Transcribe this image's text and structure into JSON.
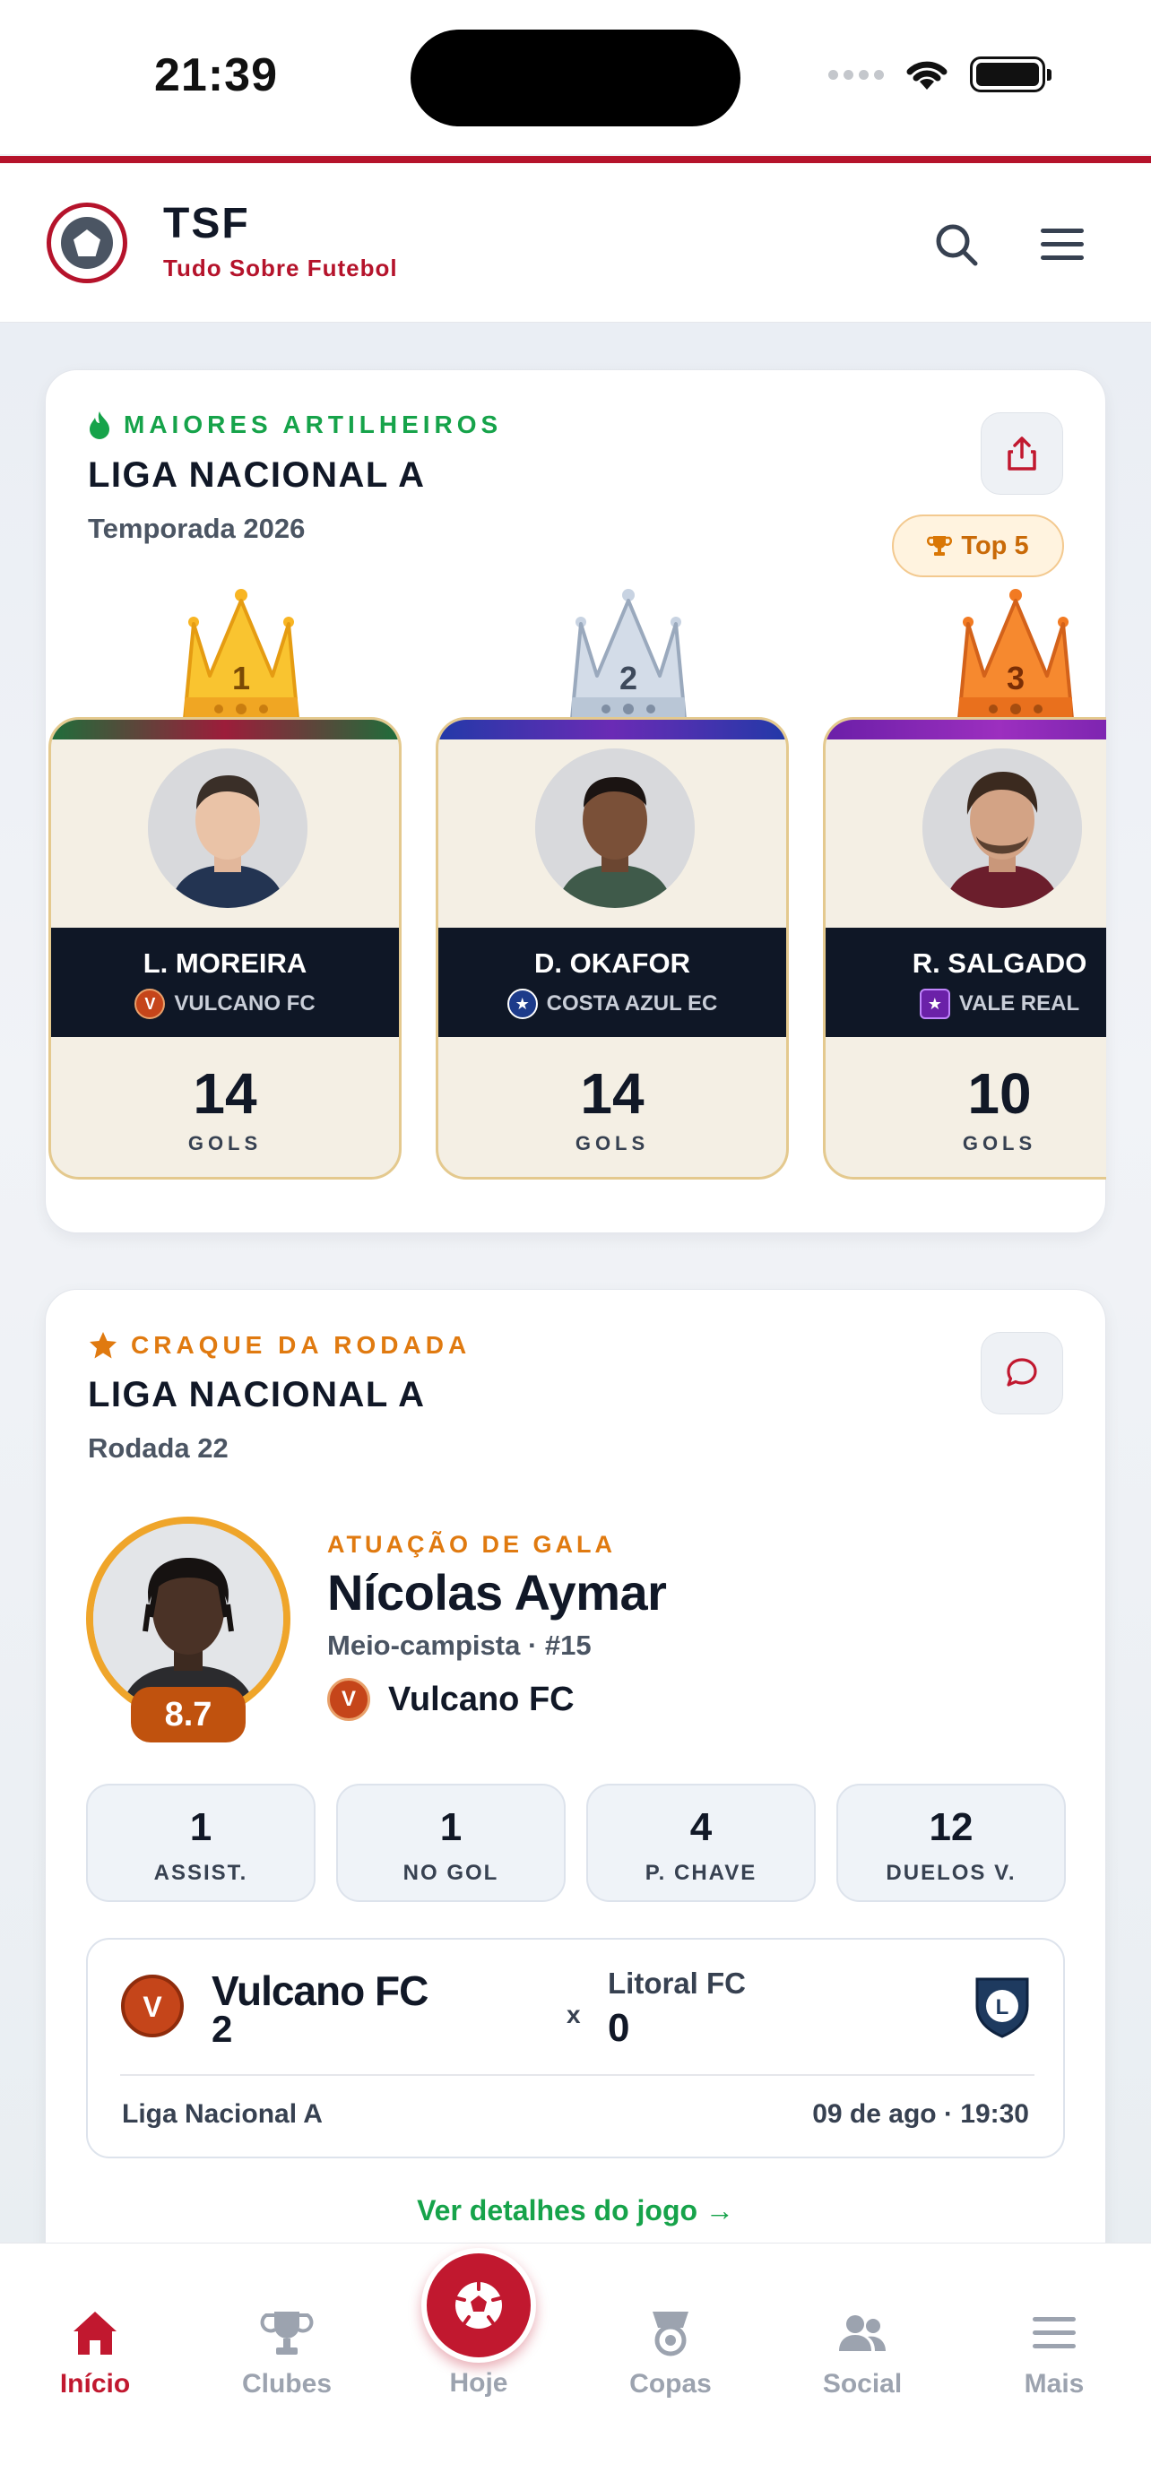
{
  "status_bar": {
    "time": "21:39"
  },
  "header": {
    "brand": "TSF",
    "tagline": "Tudo Sobre Futebol"
  },
  "top_scorers": {
    "kicker": "MAIORES ARTILHEIROS",
    "league": "LIGA NACIONAL A",
    "season": "Temporada 2026",
    "badge": "Top 5",
    "players": [
      {
        "rank": "1",
        "name": "L. MOREIRA",
        "club": "VULCANO FC",
        "goals": "14",
        "goals_label": "GOLS"
      },
      {
        "rank": "2",
        "name": "D. OKAFOR",
        "club": "COSTA AZUL EC",
        "goals": "14",
        "goals_label": "GOLS"
      },
      {
        "rank": "3",
        "name": "R. SALGADO",
        "club": "VALE REAL",
        "goals": "10",
        "goals_label": "GOLS"
      }
    ]
  },
  "player_of_round": {
    "kicker": "CRAQUE DA RODADA",
    "league": "LIGA NACIONAL A",
    "round": "Rodada 22",
    "rating": "8.7",
    "performance": "ATUAÇÃO DE GALA",
    "name": "Nícolas Aymar",
    "role": "Meio-campista · #15",
    "club": "Vulcano FC",
    "stats": [
      {
        "value": "1",
        "label": "ASSIST."
      },
      {
        "value": "1",
        "label": "NO GOL"
      },
      {
        "value": "4",
        "label": "P. CHAVE"
      },
      {
        "value": "12",
        "label": "DUELOS V."
      }
    ],
    "match": {
      "home_team": "Vulcano FC",
      "home_score": "2",
      "separator": "x",
      "away_team": "Litoral FC",
      "away_score": "0",
      "competition": "Liga Nacional A",
      "datetime": "09 de ago · 19:30"
    },
    "details_link": "Ver detalhes do jogo →"
  },
  "tabbar": {
    "items": [
      {
        "label": "Início",
        "icon": "home-icon",
        "active": true
      },
      {
        "label": "Clubes",
        "icon": "trophy-icon",
        "active": false
      },
      {
        "label": "Hoje",
        "icon": "soccer-ball-icon",
        "active": false
      },
      {
        "label": "Copas",
        "icon": "medal-icon",
        "active": false
      },
      {
        "label": "Social",
        "icon": "users-icon",
        "active": false
      },
      {
        "label": "Mais",
        "icon": "menu-icon",
        "active": false
      }
    ]
  },
  "colors": {
    "brand_red": "#b5132b",
    "green_accent": "#16a34a",
    "orange_accent": "#e07a10",
    "gold": "#f8b523",
    "silver": "#c8d3e2",
    "bronze": "#f27a22"
  }
}
